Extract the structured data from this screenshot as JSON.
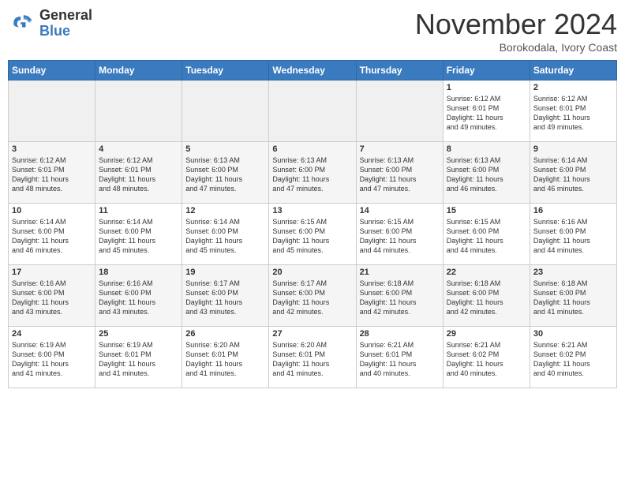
{
  "logo": {
    "line1": "General",
    "line2": "Blue"
  },
  "title": "November 2024",
  "location": "Borokodala, Ivory Coast",
  "days_of_week": [
    "Sunday",
    "Monday",
    "Tuesday",
    "Wednesday",
    "Thursday",
    "Friday",
    "Saturday"
  ],
  "weeks": [
    [
      {
        "day": "",
        "info": ""
      },
      {
        "day": "",
        "info": ""
      },
      {
        "day": "",
        "info": ""
      },
      {
        "day": "",
        "info": ""
      },
      {
        "day": "",
        "info": ""
      },
      {
        "day": "1",
        "info": "Sunrise: 6:12 AM\nSunset: 6:01 PM\nDaylight: 11 hours\nand 49 minutes."
      },
      {
        "day": "2",
        "info": "Sunrise: 6:12 AM\nSunset: 6:01 PM\nDaylight: 11 hours\nand 49 minutes."
      }
    ],
    [
      {
        "day": "3",
        "info": "Sunrise: 6:12 AM\nSunset: 6:01 PM\nDaylight: 11 hours\nand 48 minutes."
      },
      {
        "day": "4",
        "info": "Sunrise: 6:12 AM\nSunset: 6:01 PM\nDaylight: 11 hours\nand 48 minutes."
      },
      {
        "day": "5",
        "info": "Sunrise: 6:13 AM\nSunset: 6:00 PM\nDaylight: 11 hours\nand 47 minutes."
      },
      {
        "day": "6",
        "info": "Sunrise: 6:13 AM\nSunset: 6:00 PM\nDaylight: 11 hours\nand 47 minutes."
      },
      {
        "day": "7",
        "info": "Sunrise: 6:13 AM\nSunset: 6:00 PM\nDaylight: 11 hours\nand 47 minutes."
      },
      {
        "day": "8",
        "info": "Sunrise: 6:13 AM\nSunset: 6:00 PM\nDaylight: 11 hours\nand 46 minutes."
      },
      {
        "day": "9",
        "info": "Sunrise: 6:14 AM\nSunset: 6:00 PM\nDaylight: 11 hours\nand 46 minutes."
      }
    ],
    [
      {
        "day": "10",
        "info": "Sunrise: 6:14 AM\nSunset: 6:00 PM\nDaylight: 11 hours\nand 46 minutes."
      },
      {
        "day": "11",
        "info": "Sunrise: 6:14 AM\nSunset: 6:00 PM\nDaylight: 11 hours\nand 45 minutes."
      },
      {
        "day": "12",
        "info": "Sunrise: 6:14 AM\nSunset: 6:00 PM\nDaylight: 11 hours\nand 45 minutes."
      },
      {
        "day": "13",
        "info": "Sunrise: 6:15 AM\nSunset: 6:00 PM\nDaylight: 11 hours\nand 45 minutes."
      },
      {
        "day": "14",
        "info": "Sunrise: 6:15 AM\nSunset: 6:00 PM\nDaylight: 11 hours\nand 44 minutes."
      },
      {
        "day": "15",
        "info": "Sunrise: 6:15 AM\nSunset: 6:00 PM\nDaylight: 11 hours\nand 44 minutes."
      },
      {
        "day": "16",
        "info": "Sunrise: 6:16 AM\nSunset: 6:00 PM\nDaylight: 11 hours\nand 44 minutes."
      }
    ],
    [
      {
        "day": "17",
        "info": "Sunrise: 6:16 AM\nSunset: 6:00 PM\nDaylight: 11 hours\nand 43 minutes."
      },
      {
        "day": "18",
        "info": "Sunrise: 6:16 AM\nSunset: 6:00 PM\nDaylight: 11 hours\nand 43 minutes."
      },
      {
        "day": "19",
        "info": "Sunrise: 6:17 AM\nSunset: 6:00 PM\nDaylight: 11 hours\nand 43 minutes."
      },
      {
        "day": "20",
        "info": "Sunrise: 6:17 AM\nSunset: 6:00 PM\nDaylight: 11 hours\nand 42 minutes."
      },
      {
        "day": "21",
        "info": "Sunrise: 6:18 AM\nSunset: 6:00 PM\nDaylight: 11 hours\nand 42 minutes."
      },
      {
        "day": "22",
        "info": "Sunrise: 6:18 AM\nSunset: 6:00 PM\nDaylight: 11 hours\nand 42 minutes."
      },
      {
        "day": "23",
        "info": "Sunrise: 6:18 AM\nSunset: 6:00 PM\nDaylight: 11 hours\nand 41 minutes."
      }
    ],
    [
      {
        "day": "24",
        "info": "Sunrise: 6:19 AM\nSunset: 6:00 PM\nDaylight: 11 hours\nand 41 minutes."
      },
      {
        "day": "25",
        "info": "Sunrise: 6:19 AM\nSunset: 6:01 PM\nDaylight: 11 hours\nand 41 minutes."
      },
      {
        "day": "26",
        "info": "Sunrise: 6:20 AM\nSunset: 6:01 PM\nDaylight: 11 hours\nand 41 minutes."
      },
      {
        "day": "27",
        "info": "Sunrise: 6:20 AM\nSunset: 6:01 PM\nDaylight: 11 hours\nand 41 minutes."
      },
      {
        "day": "28",
        "info": "Sunrise: 6:21 AM\nSunset: 6:01 PM\nDaylight: 11 hours\nand 40 minutes."
      },
      {
        "day": "29",
        "info": "Sunrise: 6:21 AM\nSunset: 6:02 PM\nDaylight: 11 hours\nand 40 minutes."
      },
      {
        "day": "30",
        "info": "Sunrise: 6:21 AM\nSunset: 6:02 PM\nDaylight: 11 hours\nand 40 minutes."
      }
    ]
  ]
}
